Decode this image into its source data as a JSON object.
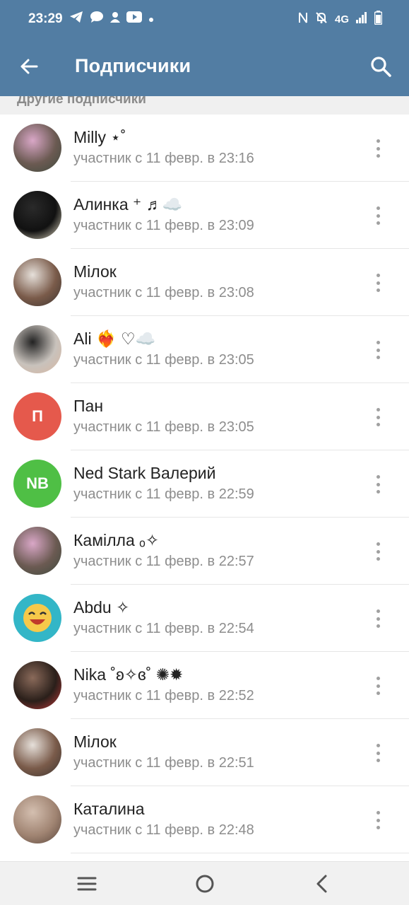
{
  "status_bar": {
    "time": "23:29",
    "network": "4G",
    "left_icons": [
      "telegram-icon",
      "chat-bubble-icon",
      "person-icon",
      "youtube-icon",
      "dot-icon"
    ],
    "right_icons": [
      "nfc-icon",
      "bell-muted-icon",
      "signal-icon",
      "battery-icon"
    ]
  },
  "app_bar": {
    "title": "Подписчики",
    "back_icon": "arrow-left-icon",
    "search_icon": "search-icon",
    "color": "#527da3"
  },
  "section": {
    "header": "Другие подписчики"
  },
  "members": [
    {
      "name": "Milly ⋆˚",
      "status": "участник с 11 февр. в 23:16",
      "avatar": {
        "type": "photo",
        "colors": [
          "#6b5a52",
          "#d9a7c7",
          "#3e4b3e"
        ]
      }
    },
    {
      "name": "Алинка ⁺ ♬☁️",
      "status": "участник с 11 февр. в 23:09",
      "avatar": {
        "type": "photo",
        "colors": [
          "#111111",
          "#2a2a2a",
          "#e8e0c8"
        ]
      }
    },
    {
      "name": "Мілок",
      "status": "участник с 11 февр. в 23:08",
      "avatar": {
        "type": "photo",
        "colors": [
          "#7a5b4a",
          "#e6e0da",
          "#3c3430"
        ]
      }
    },
    {
      "name": "Ali ❤️‍🔥 ♡☁️",
      "status": "участник с 11 февр. в 23:05",
      "avatar": {
        "type": "photo",
        "colors": [
          "#c8c2bc",
          "#222222",
          "#d9b8a2"
        ]
      }
    },
    {
      "name": "Пан",
      "status": "участник с 11 февр. в 23:05",
      "avatar": {
        "type": "initials",
        "initials": "П",
        "color": "#e5594c"
      }
    },
    {
      "name": "Ned Stark Валерий",
      "status": "участник с 11 февр. в 22:59",
      "avatar": {
        "type": "initials",
        "initials": "NB",
        "color": "#4fbf45"
      }
    },
    {
      "name": "Камілла ₒ✧",
      "status": "участник с 11 февр. в 22:57",
      "avatar": {
        "type": "photo",
        "colors": [
          "#6b5a52",
          "#d9a7c7",
          "#3e4b3e"
        ]
      }
    },
    {
      "name": "Abdu ✧",
      "status": "участник с 11 февр. в 22:54",
      "avatar": {
        "type": "emoji",
        "colors": [
          "#33b6c7",
          "#f6c94a"
        ]
      }
    },
    {
      "name": "Nika ˚ʚ✧ɞ˚ ✺✹",
      "status": "участник с 11 февр. в 22:52",
      "avatar": {
        "type": "photo",
        "colors": [
          "#2a1f1a",
          "#8a6a5a",
          "#c23a3a"
        ]
      }
    },
    {
      "name": "Мілок",
      "status": "участник с 11 февр. в 22:51",
      "avatar": {
        "type": "photo",
        "colors": [
          "#7a5b4a",
          "#e6e0da",
          "#3c3430"
        ]
      }
    },
    {
      "name": "Каталина",
      "status": "участник с 11 февр. в 22:48",
      "avatar": {
        "type": "photo",
        "colors": [
          "#a08472",
          "#d4bfb0",
          "#5a463c"
        ]
      }
    }
  ],
  "nav_bar": {
    "icons": [
      "menu-icon",
      "home-circle-icon",
      "back-chevron-icon"
    ]
  }
}
